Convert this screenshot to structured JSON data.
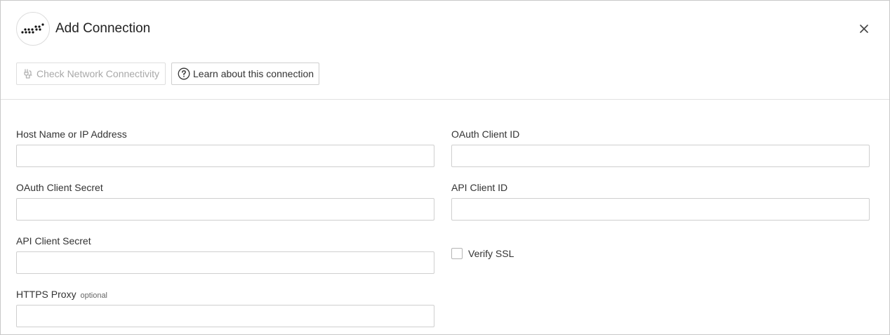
{
  "header": {
    "title": "Add Connection",
    "logo_icon": "dotted-wave-logo",
    "close_icon": "close-icon"
  },
  "toolbar": {
    "check_label": "Check Network Connectivity",
    "check_icon": "network-plug-icon",
    "learn_label": "Learn about this connection",
    "learn_icon": "question-circle-icon"
  },
  "form": {
    "host": {
      "label": "Host Name or IP Address",
      "value": ""
    },
    "oauth_client_id": {
      "label": "OAuth Client ID",
      "value": ""
    },
    "oauth_client_secret": {
      "label": "OAuth Client Secret",
      "value": ""
    },
    "api_client_id": {
      "label": "API Client ID",
      "value": ""
    },
    "api_client_secret": {
      "label": "API Client Secret",
      "value": ""
    },
    "verify_ssl": {
      "label": "Verify SSL",
      "checked": false
    },
    "https_proxy": {
      "label": "HTTPS Proxy",
      "optional": "optional",
      "value": ""
    }
  },
  "colors": {
    "border": "#cfcfcf",
    "text": "#333333",
    "disabled_text": "#a9a9a9"
  }
}
